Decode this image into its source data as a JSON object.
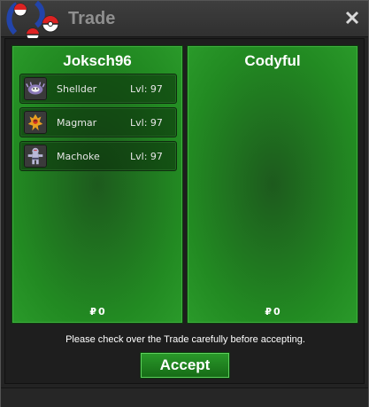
{
  "window": {
    "title": "Trade",
    "close_icon": "close-icon",
    "logo_icon": "pokeball-logo-icon"
  },
  "left_panel": {
    "player_name": "Joksch96",
    "money_symbol": "₽",
    "money": "0",
    "pokemon": [
      {
        "name": "Shellder",
        "level": "Lvl: 97",
        "icon": "shellder-sprite-icon"
      },
      {
        "name": "Magmar",
        "level": "Lvl: 97",
        "icon": "magmar-sprite-icon"
      },
      {
        "name": "Machoke",
        "level": "Lvl: 97",
        "icon": "machoke-sprite-icon"
      }
    ]
  },
  "right_panel": {
    "player_name": "Codyful",
    "money_symbol": "₽",
    "money": "0",
    "pokemon": []
  },
  "notice": "Please check over the Trade carefully before accepting.",
  "accept_label": "Accept",
  "colors": {
    "panel_green": "#228a22",
    "button_green": "#1f8a1f",
    "titlebar": "#363636"
  }
}
